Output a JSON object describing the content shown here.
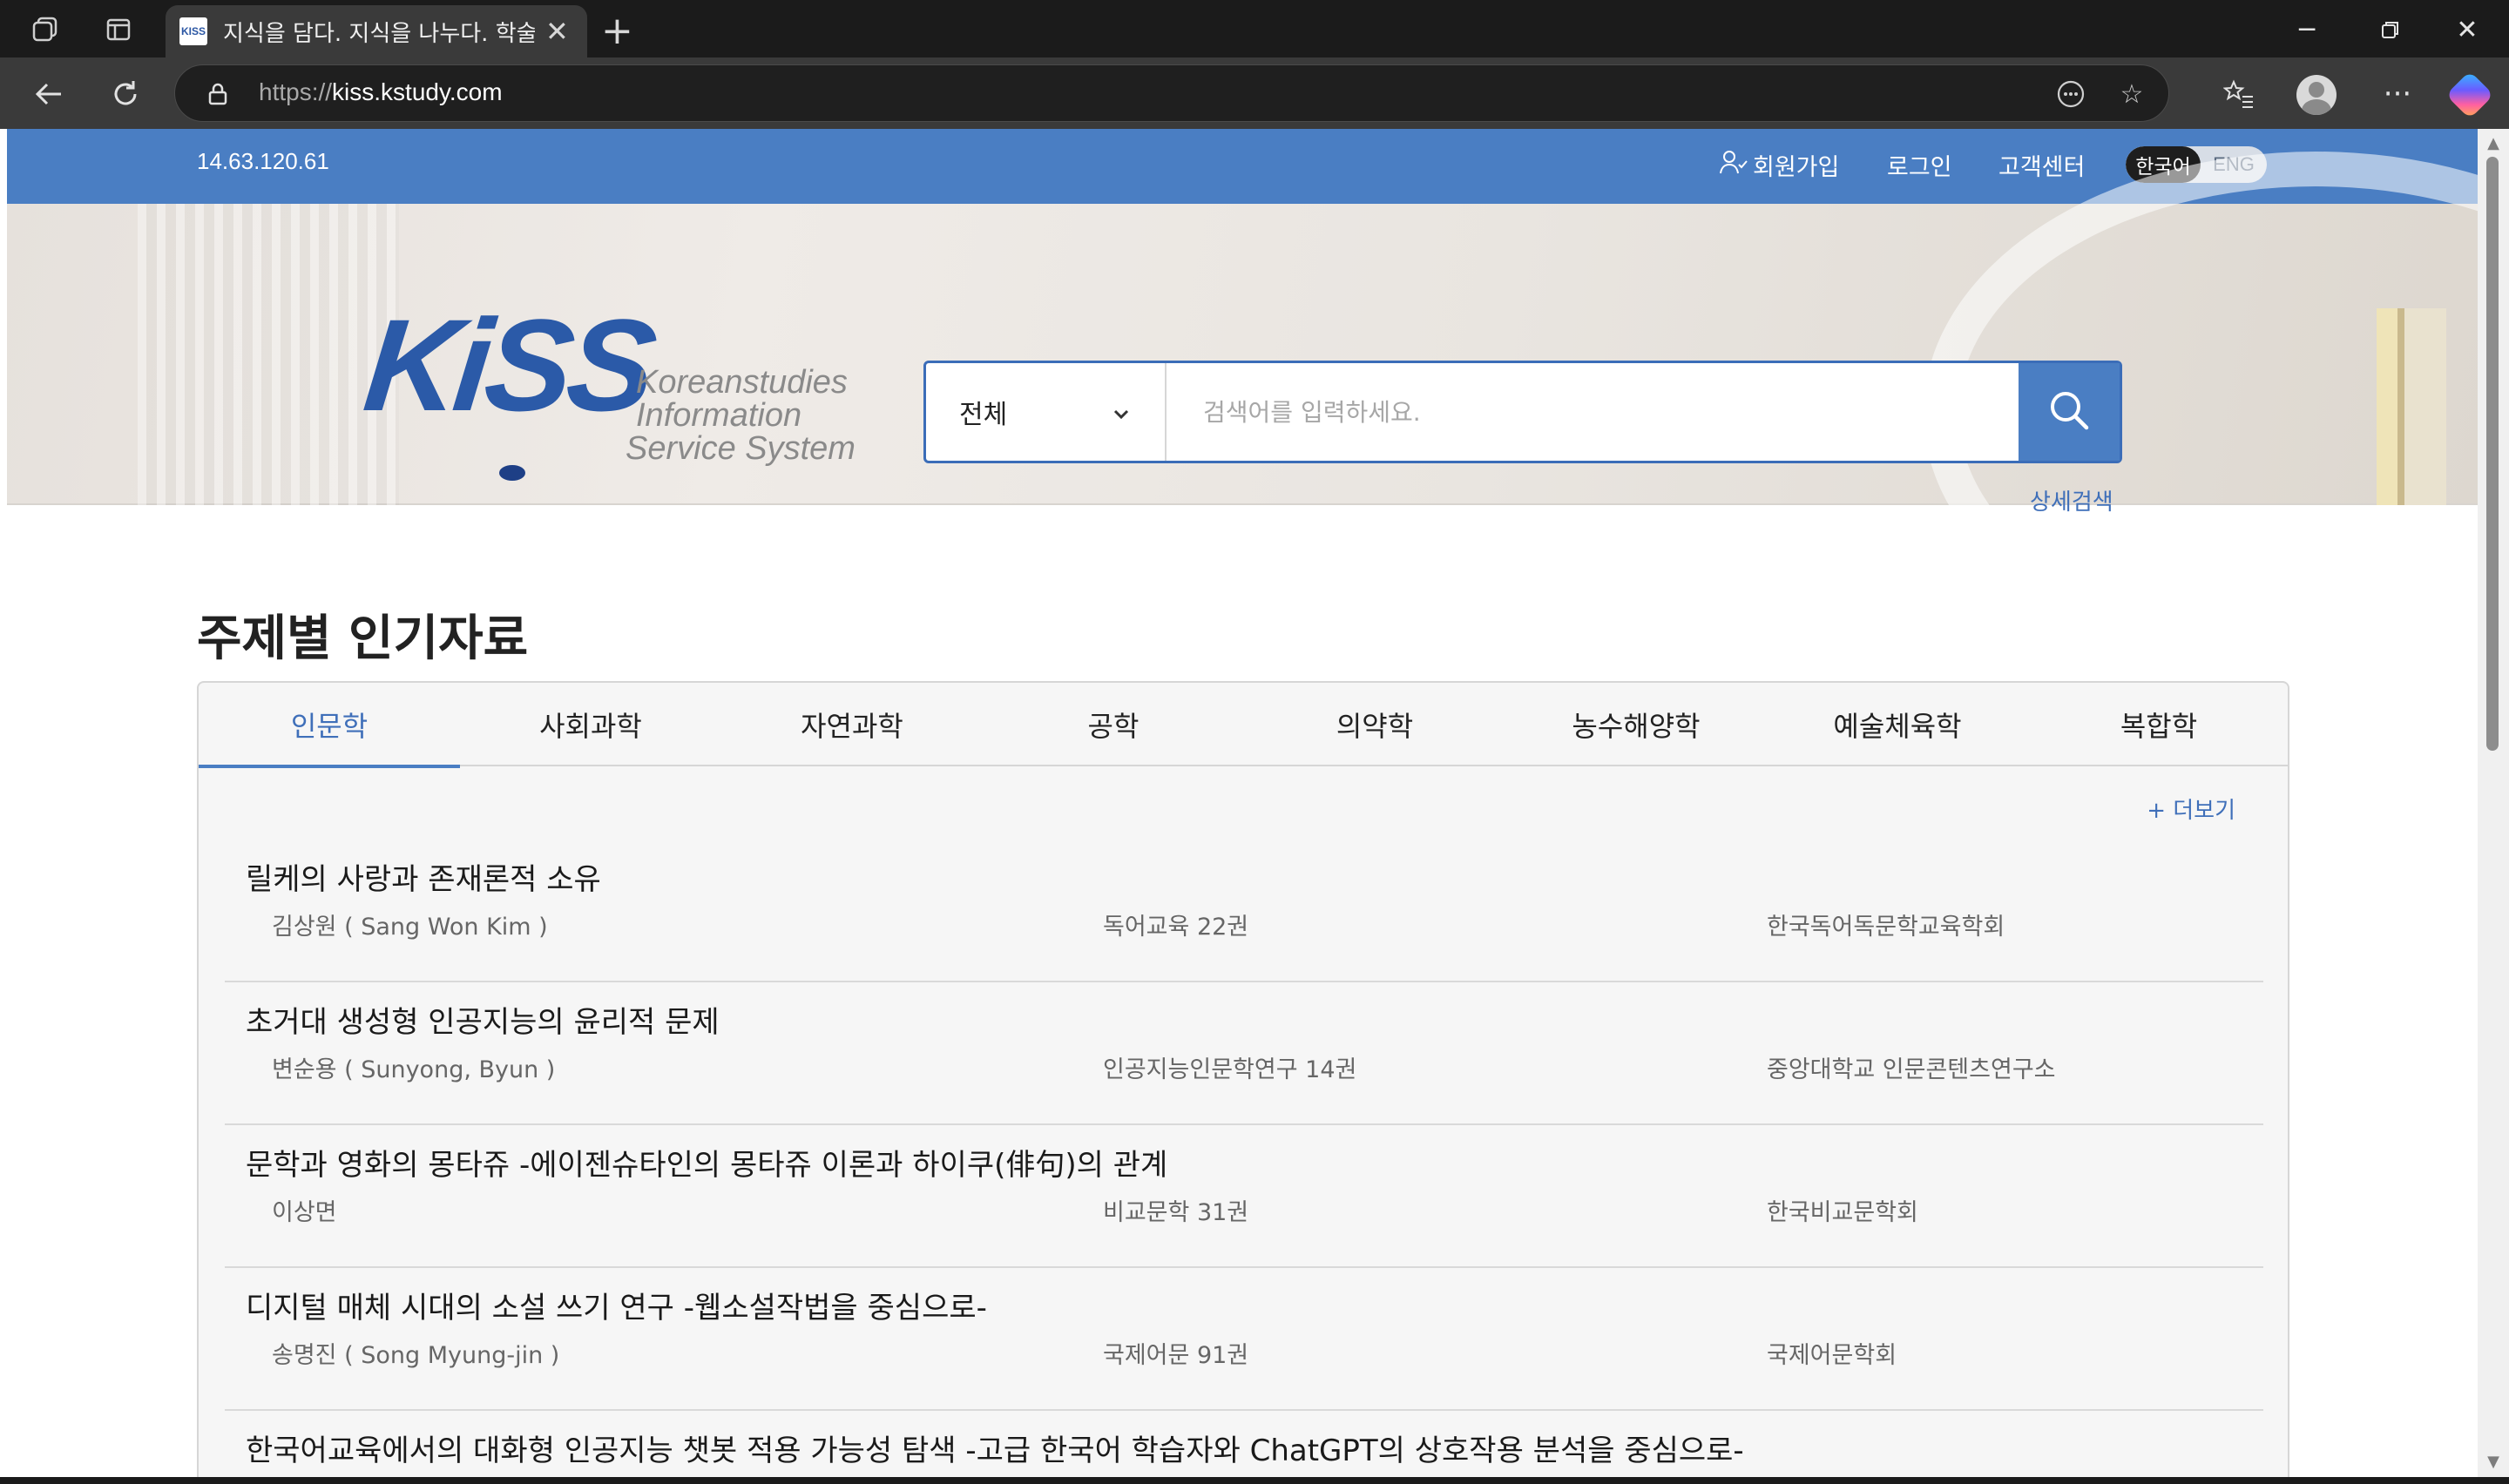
{
  "browser": {
    "tab_title": "지식을 담다. 지식을 나누다. 학술",
    "url_proto": "https://",
    "url_host": "kiss.kstudy.com",
    "tab_favicon_text": "KISS"
  },
  "header": {
    "ip": "14.63.120.61",
    "signup": "회원가입",
    "login": "로그인",
    "support": "고객센터",
    "lang_ko": "한국어",
    "lang_en": "ENG"
  },
  "logo": {
    "main": "KiSS",
    "line1": "Koreanstudies",
    "line2": "Information",
    "line3": "Service System"
  },
  "search": {
    "scope": "전체",
    "placeholder": "검색어를 입력하세요.",
    "advanced": "상세검색"
  },
  "section": {
    "title": "주제별 인기자료",
    "more": "+ 더보기",
    "tabs": [
      "인문학",
      "사회과학",
      "자연과학",
      "공학",
      "의약학",
      "농수해양학",
      "예술체육학",
      "복합학"
    ],
    "active_tab": 0,
    "items": [
      {
        "title": "릴케의 사랑과 존재론적 소유",
        "author": "김상원 ( Sang Won Kim )",
        "journal": "독어교육 22권",
        "publisher": "한국독어독문학교육학회"
      },
      {
        "title": "초거대 생성형 인공지능의 윤리적 문제",
        "author": "변순용 ( Sunyong, Byun )",
        "journal": "인공지능인문학연구 14권",
        "publisher": "중앙대학교 인문콘텐츠연구소"
      },
      {
        "title": "문학과 영화의 몽타쥬 -에이젠슈타인의 몽타쥬 이론과 하이쿠(俳句)의 관계",
        "author": "이상면",
        "journal": "비교문학 31권",
        "publisher": "한국비교문학회"
      },
      {
        "title": "디지털 매체 시대의 소설 쓰기 연구 -웹소설작법을 중심으로-",
        "author": "송명진 ( Song Myung-jin )",
        "journal": "국제어문 91권",
        "publisher": "국제어문학회"
      },
      {
        "title": "한국어교육에서의 대화형 인공지능 챗봇 적용 가능성 탐색 -고급 한국어 학습자와 ChatGPT의 상호작용 분석을 중심으로-",
        "author": "",
        "journal": "",
        "publisher": ""
      }
    ]
  },
  "colors": {
    "brand_blue": "#4a7ec3",
    "link_blue": "#3f6fb9",
    "logo_blue": "#2b5aa8"
  }
}
